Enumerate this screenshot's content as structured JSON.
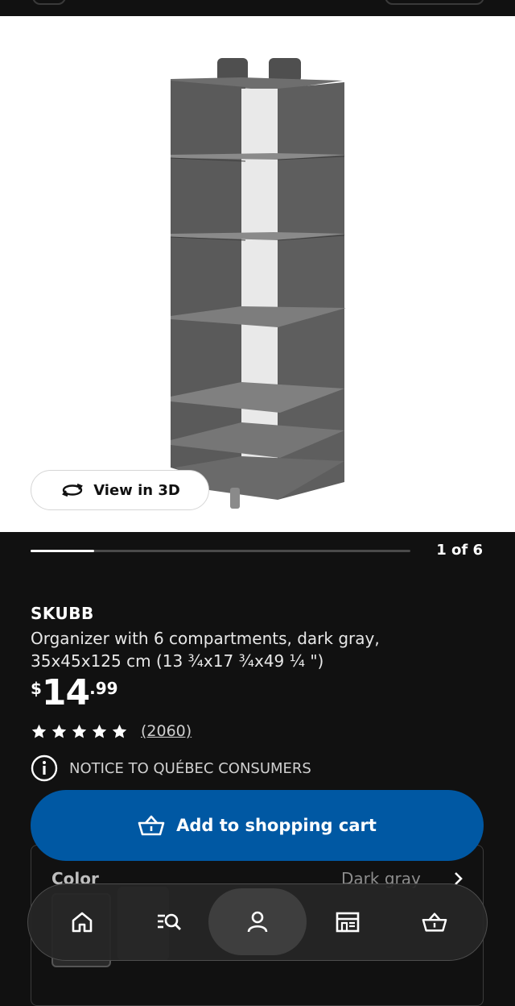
{
  "gallery": {
    "view_3d_label": "View in 3D",
    "page_counter": "1 of 6",
    "progress_fraction": 0.167
  },
  "product": {
    "name": "SKUBB",
    "description": "Organizer with 6 compartments, dark gray, 35x45x125 cm (13 ¾x17 ¾x49 ¼ \")",
    "price": {
      "currency": "$",
      "whole": "14",
      "cents": ".99"
    },
    "rating": {
      "stars": 5,
      "max": 5,
      "reviews": "(2060)"
    },
    "notice": "NOTICE TO QUÉBEC CONSUMERS"
  },
  "actions": {
    "add_to_cart": "Add to shopping cart"
  },
  "color_selector": {
    "label": "Color",
    "value": "Dark gray"
  },
  "bottom_nav": {
    "items": [
      {
        "name": "home",
        "icon": "home-icon"
      },
      {
        "name": "search",
        "icon": "search-list-icon"
      },
      {
        "name": "profile",
        "icon": "person-icon",
        "active": true
      },
      {
        "name": "stores",
        "icon": "store-icon"
      },
      {
        "name": "cart",
        "icon": "basket-icon"
      }
    ]
  },
  "colors": {
    "background": "#111111",
    "brand_blue": "#0058a3",
    "text": "#ffffff"
  }
}
